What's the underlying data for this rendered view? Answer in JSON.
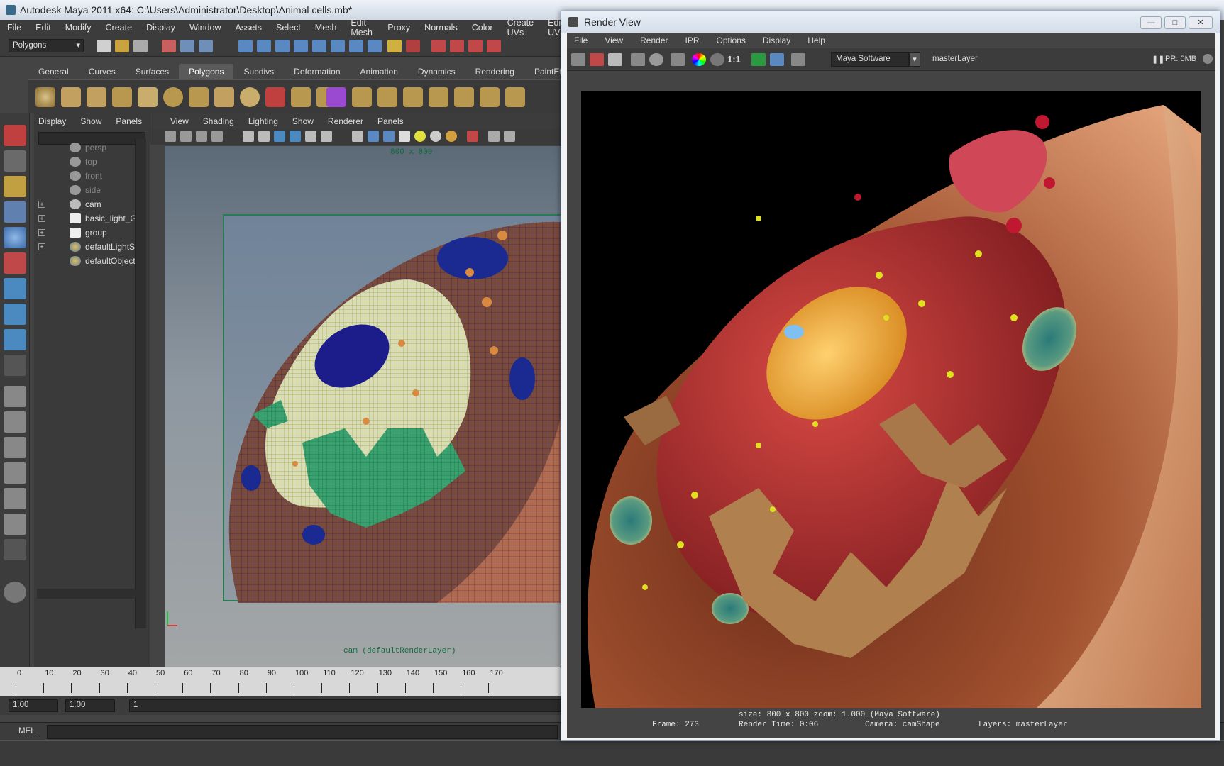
{
  "maya": {
    "title": "Autodesk Maya 2011 x64: C:\\Users\\Administrator\\Desktop\\Animal cells.mb*",
    "menu": [
      "File",
      "Edit",
      "Modify",
      "Create",
      "Display",
      "Window",
      "Assets",
      "Select",
      "Mesh",
      "Edit Mesh",
      "Proxy",
      "Normals",
      "Color",
      "Create UVs",
      "Edit UVs"
    ],
    "mode_select": "Polygons",
    "shelf_tabs": [
      "General",
      "Curves",
      "Surfaces",
      "Polygons",
      "Subdivs",
      "Deformation",
      "Animation",
      "Dynamics",
      "Rendering",
      "PaintEffe"
    ],
    "active_shelf_tab": "Polygons"
  },
  "outliner": {
    "menu": [
      "Display",
      "Show",
      "Panels"
    ],
    "items": [
      {
        "label": "persp",
        "dim": true,
        "expand": ""
      },
      {
        "label": "top",
        "dim": true,
        "expand": ""
      },
      {
        "label": "front",
        "dim": true,
        "expand": ""
      },
      {
        "label": "side",
        "dim": true,
        "expand": ""
      },
      {
        "label": "cam",
        "dim": false,
        "expand": "+"
      },
      {
        "label": "basic_light_G",
        "dim": false,
        "expand": "+"
      },
      {
        "label": "group",
        "dim": false,
        "expand": "+"
      },
      {
        "label": "defaultLightSe",
        "dim": false,
        "expand": "+"
      },
      {
        "label": "defaultObjectS",
        "dim": false,
        "expand": ""
      }
    ]
  },
  "viewport": {
    "menu": [
      "View",
      "Shading",
      "Lighting",
      "Show",
      "Renderer",
      "Panels"
    ],
    "resolution_label": "800 x 800",
    "camera_label": "cam (defaultRenderLayer)"
  },
  "timeline": {
    "numbers": [
      "0",
      "10",
      "20",
      "30",
      "40",
      "50",
      "60",
      "70",
      "80",
      "90",
      "100",
      "110",
      "120",
      "130",
      "140",
      "150",
      "160",
      "170"
    ],
    "start_field": "1.00",
    "current_field": "1.00",
    "frame_field": "1"
  },
  "mel": {
    "label": "MEL"
  },
  "render_view": {
    "title": "Render View",
    "menu": [
      "File",
      "View",
      "Render",
      "IPR",
      "Options",
      "Display",
      "Help"
    ],
    "renderer": "Maya Software",
    "layer": "masterLayer",
    "ipr": "IPR: 0MB",
    "ratio_label": "1:1",
    "info_line1": "size: 800 x 800 zoom: 1.000          (Maya Software)",
    "info_frame": "Frame: 273",
    "info_time": "Render Time: 0:06",
    "info_camera": "Camera: camShape",
    "info_layers": "Layers: masterLayer"
  },
  "colors": {
    "accent_green": "#2a7a52",
    "active_tab": "#5a5a5a"
  }
}
